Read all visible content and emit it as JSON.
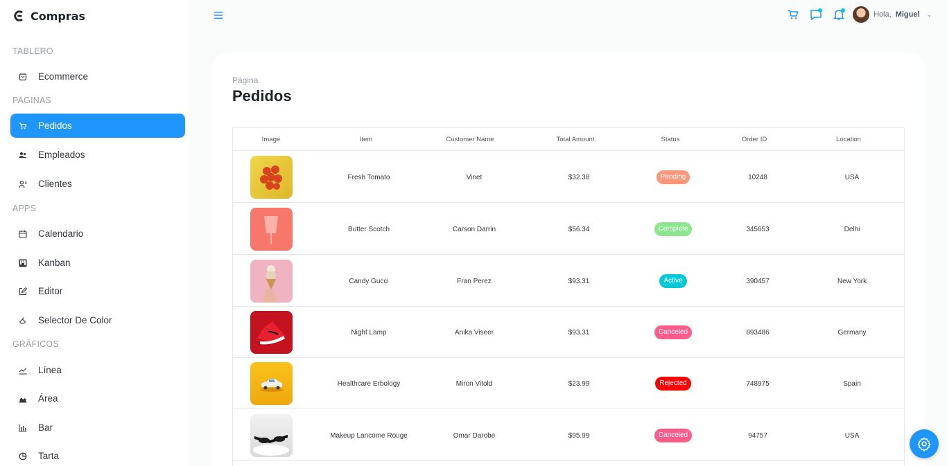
{
  "brand": {
    "title": "Compras",
    "icon": "shopify-like-logo-icon"
  },
  "sidebar": {
    "sections": [
      {
        "label": "TABLERO"
      },
      {
        "label": "PAGINAS"
      },
      {
        "label": "APPS"
      },
      {
        "label": "GRÁFICOS"
      }
    ],
    "items": [
      {
        "label": "Ecommerce",
        "icon": "shopping-bag-icon",
        "active": false
      },
      {
        "label": "Pedidos",
        "icon": "cart-icon",
        "active": true
      },
      {
        "label": "Empleados",
        "icon": "employees-icon",
        "active": false
      },
      {
        "label": "Clientes",
        "icon": "customers-icon",
        "active": false
      },
      {
        "label": "Calendario",
        "icon": "calendar-icon",
        "active": false
      },
      {
        "label": "Kanban",
        "icon": "kanban-icon",
        "active": false
      },
      {
        "label": "Editor",
        "icon": "edit-icon",
        "active": false
      },
      {
        "label": "Selector De Color",
        "icon": "color-picker-icon",
        "active": false
      },
      {
        "label": "Línea",
        "icon": "line-chart-icon",
        "active": false
      },
      {
        "label": "Área",
        "icon": "area-chart-icon",
        "active": false
      },
      {
        "label": "Bar",
        "icon": "bar-chart-icon",
        "active": false
      },
      {
        "label": "Tarta",
        "icon": "pie-chart-icon",
        "active": false
      }
    ]
  },
  "topbar": {
    "greeting": "Hola,",
    "user_name": "Miguel",
    "icons": [
      "cart-icon",
      "chat-icon",
      "notification-icon"
    ]
  },
  "page": {
    "crumb": "Página",
    "title": "Pedidos"
  },
  "table": {
    "headers": [
      "Image",
      "Item",
      "Customer Name",
      "Total Amount",
      "Status",
      "Order ID",
      "Location"
    ],
    "rows": [
      {
        "item": "Fresh Tomato",
        "customer": "Vinet",
        "amount": "$32.38",
        "status": "Pending",
        "status_color": "#fb9678",
        "order_id": "10248",
        "location": "USA",
        "thumb": "tomatoes"
      },
      {
        "item": "Butter Scotch",
        "customer": "Carson Darrin",
        "amount": "$56.34",
        "status": "Complete",
        "status_color": "#8be78b",
        "order_id": "345653",
        "location": "Delhi",
        "thumb": "drink"
      },
      {
        "item": "Candy Gucci",
        "customer": "Fran Perez",
        "amount": "$93.31",
        "status": "Active",
        "status_color": "#03c9d7",
        "order_id": "390457",
        "location": "New York",
        "thumb": "icecream"
      },
      {
        "item": "Night Lamp",
        "customer": "Anika Viseer",
        "amount": "$93.31",
        "status": "Canceled",
        "status_color": "#ff5c8e",
        "order_id": "893486",
        "location": "Germany",
        "thumb": "sneaker"
      },
      {
        "item": "Healthcare Erbology",
        "customer": "Miron Vitold",
        "amount": "$23.99",
        "status": "Rejected",
        "status_color": "#ff0000",
        "order_id": "748975",
        "location": "Spain",
        "thumb": "car"
      },
      {
        "item": "Makeup Lancome Rouge",
        "customer": "Omar Darobe",
        "amount": "$95.99",
        "status": "Canceled",
        "status_color": "#ff5c8e",
        "order_id": "94757",
        "location": "USA",
        "thumb": "sunglasses"
      }
    ]
  },
  "colors": {
    "accent": "#1e96fc",
    "dot": "#03c9d7"
  }
}
